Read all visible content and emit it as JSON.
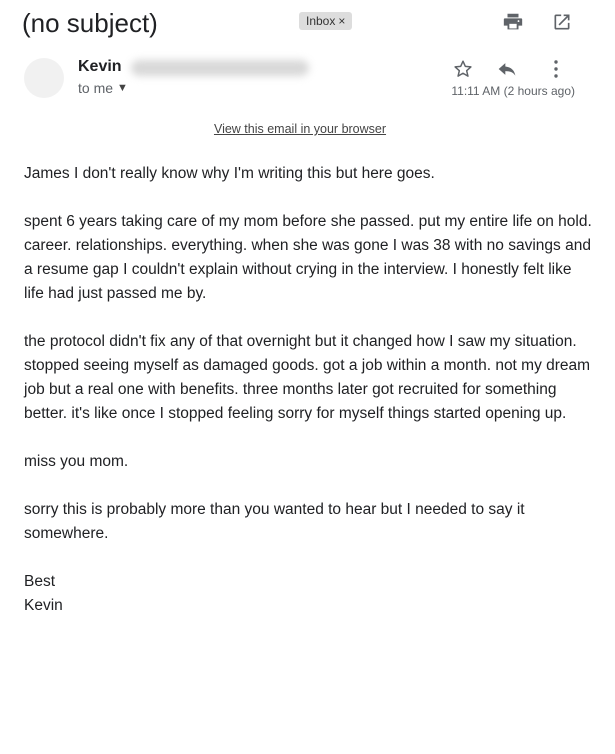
{
  "header": {
    "subject": "(no subject)",
    "label_badge": "Inbox",
    "label_remove": "×",
    "print_icon": "print-icon",
    "popout_icon": "open-in-new-window-icon"
  },
  "sender": {
    "name": "Kevin",
    "to_label": "to me",
    "to_caret": "▼",
    "avatar_icon": "avatar-placeholder",
    "timestamp": "11:11 AM (2 hours ago)",
    "star_icon": "star-icon",
    "reply_icon": "reply-icon",
    "more_icon": "more-vertical-icon"
  },
  "view_in_browser": "View this email in your browser",
  "message": {
    "greeting": "James I don't really know why I'm writing this but here goes.",
    "paragraph_1": "spent 6 years taking care of my mom before she passed. put my entire life on hold. career. relationships. everything. when she was gone I was 38 with no savings and a resume gap I couldn't explain without crying in the interview. I honestly felt like life had just passed me by.",
    "paragraph_2": "the protocol didn't fix any of that overnight but it changed how I saw my situation. stopped seeing myself as damaged goods. got a job within a month. not my dream job but a real one with benefits. three months later got recruited for something better. it's like once I stopped feeling sorry for myself things started opening up.",
    "paragraph_3": "miss you mom.",
    "paragraph_4": "sorry this is probably more than you wanted to hear but I needed to say it somewhere.",
    "closing": "Best",
    "signature": "Kevin"
  }
}
